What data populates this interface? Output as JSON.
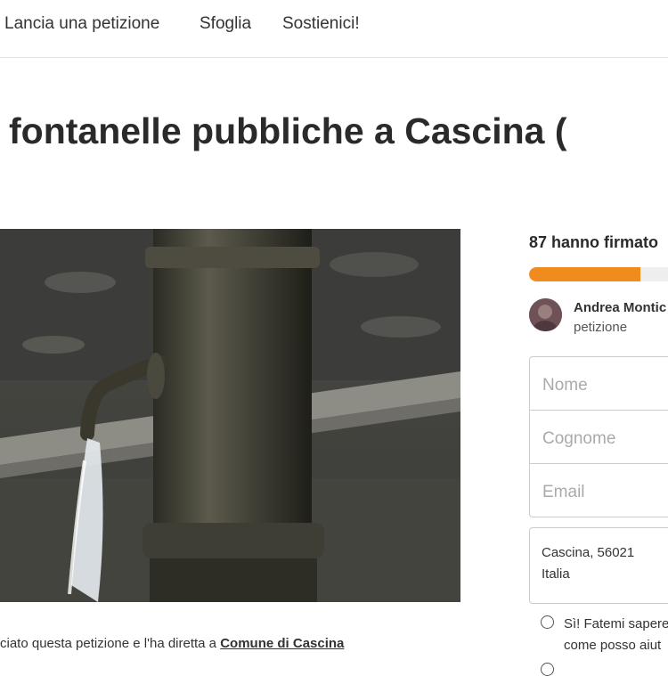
{
  "nav": {
    "start_label": "Lancia una petizione",
    "browse_label": "Sfoglia",
    "support_label": "Sostienici!"
  },
  "petition": {
    "title": "fontanelle pubbliche a Cascina (",
    "caption_prefix": "ciato questa petizione e l'ha diretta a ",
    "caption_target": "Comune di Cascina"
  },
  "signatures": {
    "count_text": "87 hanno firmato",
    "progress_fraction": 0.8
  },
  "author": {
    "name": "Andrea Montic",
    "role": "petizione"
  },
  "form": {
    "first_name_placeholder": "Nome",
    "last_name_placeholder": "Cognome",
    "email_placeholder": "Email",
    "location_line1": "Cascina, 56021",
    "location_line2": "Italia",
    "option_yes_line1": "Sì! Fatemi sapere",
    "option_yes_line2": "come posso aiut"
  },
  "colors": {
    "accent": "#f08b1e"
  }
}
